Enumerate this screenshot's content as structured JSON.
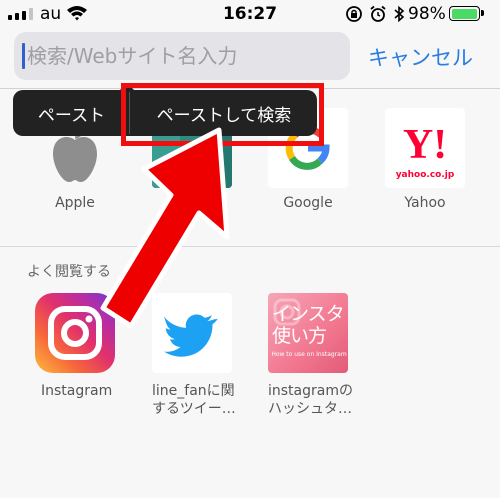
{
  "status_bar": {
    "carrier": "au",
    "time": "16:27",
    "battery_percent": "98%",
    "battery_level": 0.98,
    "signal_bars": 3,
    "icons": [
      "signal-icon",
      "wifi-icon",
      "rotation-lock-icon",
      "alarm-icon",
      "bluetooth-icon",
      "battery-icon"
    ]
  },
  "search": {
    "placeholder": "検索/Webサイト名入力",
    "value": "",
    "cancel_label": "キャンセル"
  },
  "paste_menu": {
    "paste_label": "ペースト",
    "paste_and_search_label": "ペーストして検索"
  },
  "favorites": {
    "items": [
      {
        "label": "Apple",
        "icon": "apple-logo-icon"
      },
      {
        "label": "",
        "icon": "maps-icon"
      },
      {
        "label": "Google",
        "icon": "google-logo-icon"
      },
      {
        "label": "Yahoo",
        "icon": "yahoo-logo-icon",
        "logo_caption": "yahoo.co.jp"
      }
    ]
  },
  "frequently_visited": {
    "header": "よく閲覧する",
    "items": [
      {
        "label": "Instagram",
        "icon": "instagram-logo-icon"
      },
      {
        "label_line1": "line_fanに関",
        "label_line2": "するツイー…",
        "icon": "twitter-bird-icon"
      },
      {
        "label_line1": "instagramの",
        "label_line2": "ハッシュタ…",
        "icon": "article-thumbnail",
        "thumb_text": "インスタ使い方",
        "thumb_subtext": "How to use on Instagram"
      }
    ]
  },
  "annotations": {
    "highlight_color": "#f10e0e",
    "arrow_icon": "red-arrow-icon"
  },
  "colors": {
    "accent": "#2a7de1",
    "menu_bg": "#222222",
    "battery_green": "#4cd964",
    "google_blue": "#4285f4",
    "google_red": "#ea4335",
    "google_yellow": "#fbbc05",
    "google_green": "#34a853",
    "yahoo_red": "#ff0033",
    "twitter_blue": "#1da1f2"
  }
}
